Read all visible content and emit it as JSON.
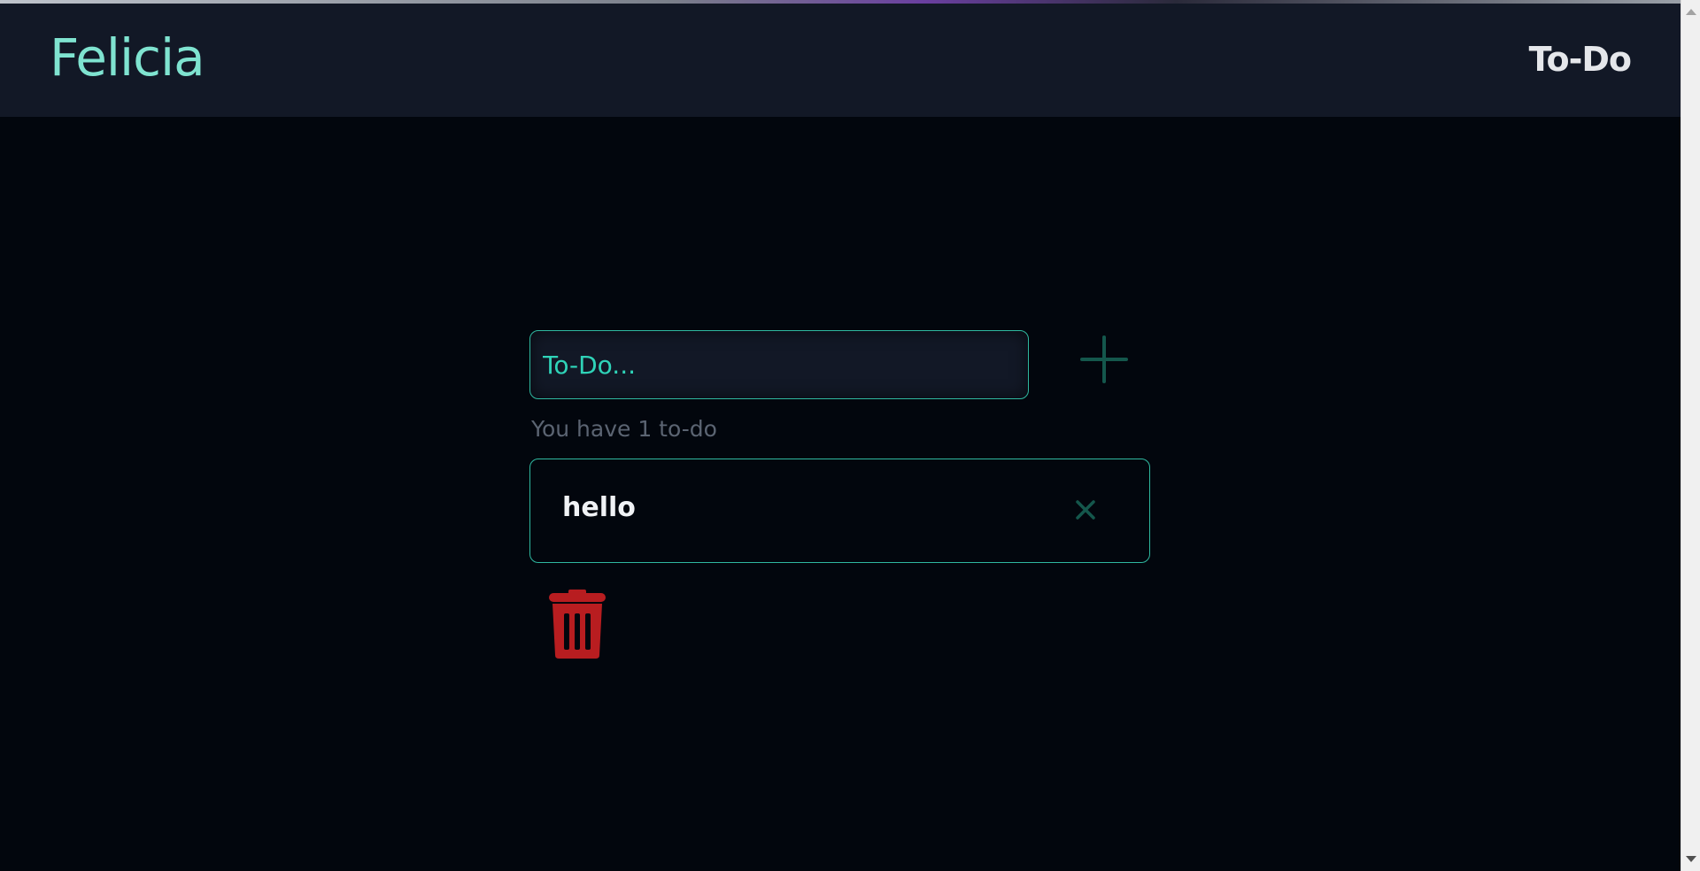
{
  "navbar": {
    "brand": "Felicia",
    "link": "To-Do"
  },
  "todo_form": {
    "placeholder": "To-Do...",
    "value": "",
    "add_icon": "plus-icon"
  },
  "summary": {
    "count_text": "You have 1 to-do"
  },
  "todos": [
    {
      "text": "hello",
      "remove_icon": "close-icon"
    }
  ],
  "actions": {
    "clear_icon": "trash-icon"
  },
  "colors": {
    "background": "#02060d",
    "navbar": "#121826",
    "accent": "#2fb8a0",
    "brand": "#7fe3d0",
    "icon_teal": "#14574c",
    "danger": "#b81d20"
  }
}
